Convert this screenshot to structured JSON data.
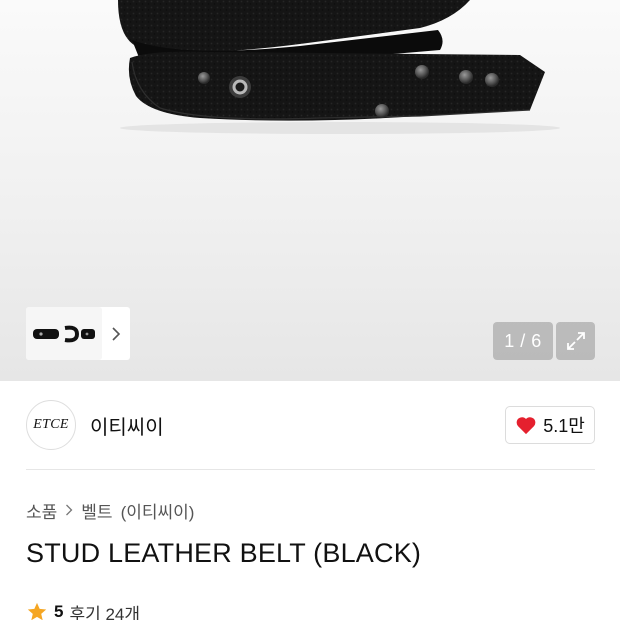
{
  "gallery": {
    "counter": "1 / 6",
    "thumbnail_label": "belt thumbnail",
    "icons": {
      "next": "chevron-right-icon",
      "expand": "expand-arrows-icon"
    }
  },
  "brand": {
    "logo_text": "ETCE",
    "name": "이티씨이",
    "likes": "5.1만",
    "like_icon": "heart-icon",
    "like_color": "#e5202e"
  },
  "breadcrumb": {
    "items": [
      "소품",
      "벨트",
      "(이티씨이)"
    ]
  },
  "product": {
    "title": "STUD LEATHER BELT (BLACK)"
  },
  "rating": {
    "score": "5",
    "reviews": "후기 24개",
    "star_color": "#f5a623"
  }
}
